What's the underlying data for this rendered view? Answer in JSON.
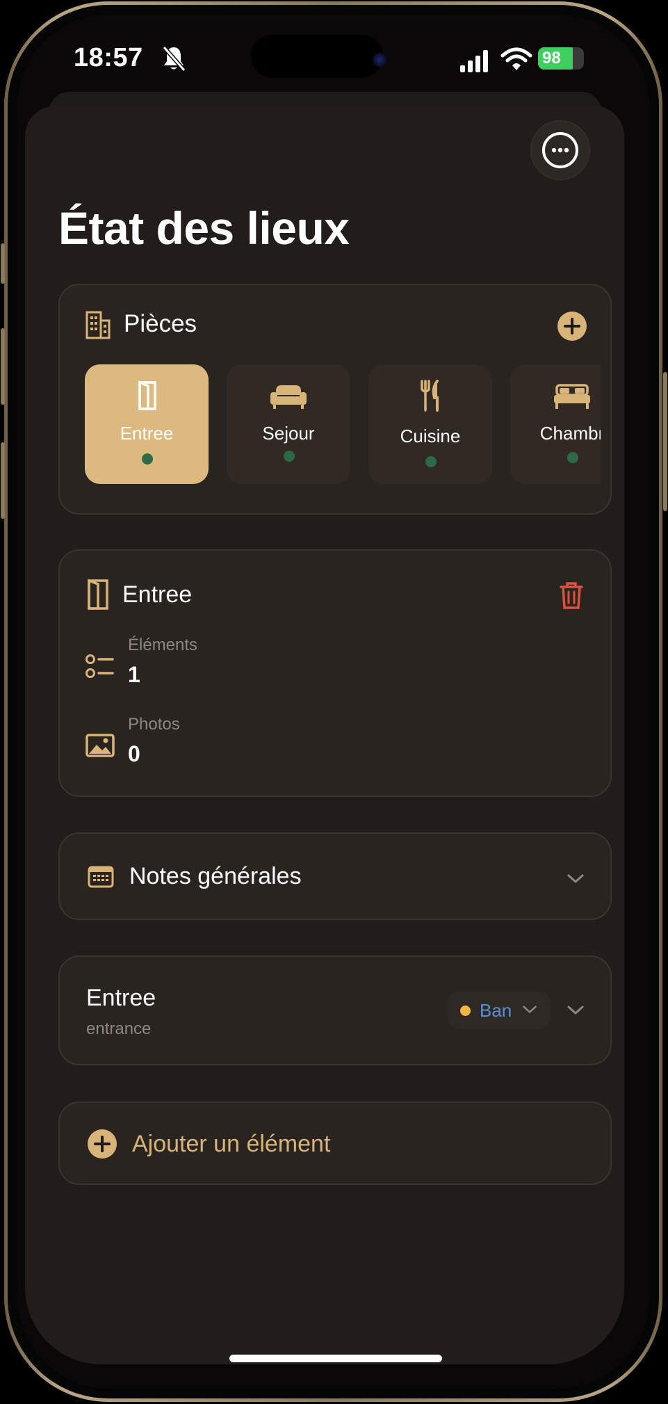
{
  "status_bar": {
    "time": "18:57",
    "battery": "98"
  },
  "header": {
    "title": "État des lieux",
    "more_icon": "ellipsis-circle-icon"
  },
  "rooms": {
    "title": "Pièces",
    "icon": "building-icon",
    "add_icon": "plus-circle-icon",
    "items": [
      {
        "label": "Entree",
        "icon": "door-icon",
        "active": true
      },
      {
        "label": "Sejour",
        "icon": "sofa-icon",
        "active": false
      },
      {
        "label": "Cuisine",
        "icon": "fork-knife-icon",
        "active": false
      },
      {
        "label": "Chambr",
        "icon": "bed-icon",
        "active": false
      }
    ],
    "status_color": "#2e6a48",
    "active_color": "#dcb97e"
  },
  "room_detail": {
    "title": "Entree",
    "elements_label": "Éléments",
    "elements_value": "1",
    "photos_label": "Photos",
    "photos_value": "0",
    "delete_color": "#d9533f"
  },
  "notes": {
    "title": "Notes générales"
  },
  "element": {
    "title": "Entree",
    "subtitle": "entrance",
    "state": "Ban",
    "state_dot_color": "#f5b73b",
    "state_text_color": "#5b8ed8"
  },
  "add_element": {
    "label": "Ajouter un élément",
    "accent_color": "#d9b478"
  }
}
